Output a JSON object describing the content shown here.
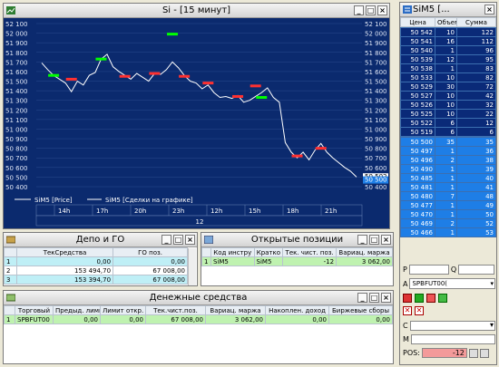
{
  "chart_window": {
    "title": "Si - [15 минут]",
    "y_ticks": [
      "52 100",
      "52 000",
      "51 900",
      "51 800",
      "51 700",
      "51 600",
      "51 500",
      "51 400",
      "51 300",
      "51 200",
      "51 100",
      "51 000",
      "50 900",
      "50 800",
      "50 700",
      "50 600",
      "50 500",
      "50 400"
    ],
    "right_labels": {
      "current": "50 502",
      "bid": "50 500"
    },
    "legend": {
      "price": "SiM5 [Price]",
      "deals": "SiM5 [Сделки на графике]"
    },
    "x_ticks": [
      "14h",
      "17h",
      "20h",
      "23h",
      "12h",
      "15h",
      "18h",
      "21h"
    ],
    "date_label": "12",
    "colors": {
      "bg": "#0b2a6e",
      "line": "#ffffff",
      "buy": "#00ff00",
      "sell": "#ff3030",
      "grid": "#2a4b8e"
    }
  },
  "chart_data": {
    "type": "line",
    "series": [
      {
        "name": "SiM5 [Price]",
        "values": [
          51690,
          51620,
          51560,
          51520,
          51480,
          51390,
          51500,
          51460,
          51560,
          51590,
          51730,
          51780,
          51650,
          51600,
          51560,
          51520,
          51580,
          51540,
          51500,
          51580,
          51570,
          51620,
          51700,
          51640,
          51560,
          51500,
          51480,
          51420,
          51460,
          51380,
          51330,
          51340,
          51320,
          51350,
          51280,
          51300,
          51340,
          51380,
          51430,
          51330,
          51280,
          50860,
          50760,
          50700,
          50760,
          50680,
          50780,
          50850,
          50760,
          50700,
          50650,
          50600,
          50560,
          50500
        ]
      }
    ],
    "deals_buy": [
      {
        "i": 2,
        "y": 51560
      },
      {
        "i": 10,
        "y": 51730
      },
      {
        "i": 22,
        "y": 51990
      },
      {
        "i": 37,
        "y": 51330
      }
    ],
    "deals_sell": [
      {
        "i": 5,
        "y": 51520
      },
      {
        "i": 14,
        "y": 51550
      },
      {
        "i": 19,
        "y": 51580
      },
      {
        "i": 24,
        "y": 51550
      },
      {
        "i": 28,
        "y": 51480
      },
      {
        "i": 33,
        "y": 51340
      },
      {
        "i": 36,
        "y": 51450
      },
      {
        "i": 43,
        "y": 50720
      },
      {
        "i": 47,
        "y": 50800
      }
    ],
    "ylim": [
      50400,
      52100
    ],
    "grid": true,
    "legend": "bottom-left"
  },
  "depo_window": {
    "title": "Депо и ГО",
    "headers": [
      "",
      "ТекСредства",
      "ГО поз."
    ],
    "rows": [
      [
        "1",
        "0,00",
        "0,00"
      ],
      [
        "2",
        "153 494,70",
        "67 008,00"
      ],
      [
        "3",
        "153 394,70",
        "67 008,00"
      ]
    ]
  },
  "positions_window": {
    "title": "Открытые позиции",
    "headers": [
      "",
      "Код инстру",
      "Кратко",
      "Тек. чист. поз.",
      "Вариац. маржа"
    ],
    "rows": [
      [
        "1",
        "SiM5",
        "SiM5",
        "-12",
        "3 062,00"
      ]
    ]
  },
  "money_window": {
    "title": "Денежные средства",
    "headers": [
      "",
      "Торговый",
      "Предыд. лими",
      "Лимит откр.",
      "Тек.чист.поз.",
      "Вариац. маржа",
      "Накоплен. доход",
      "Биржевые сборы"
    ],
    "rows": [
      [
        "1",
        "SPBFUT00",
        "0,00",
        "0,00",
        "67 008,00",
        "3 062,00",
        "0,00",
        "0,00"
      ]
    ]
  },
  "orderbook_window": {
    "title": "SiM5 [...",
    "headers": [
      "Цена",
      "Объем",
      "Сумма"
    ],
    "asks": [
      [
        "50 542",
        "10",
        "122"
      ],
      [
        "50 541",
        "16",
        "112"
      ],
      [
        "50 540",
        "1",
        "96"
      ],
      [
        "50 539",
        "12",
        "95"
      ],
      [
        "50 538",
        "1",
        "83"
      ],
      [
        "50 533",
        "10",
        "82"
      ],
      [
        "50 529",
        "30",
        "72"
      ],
      [
        "50 527",
        "10",
        "42"
      ],
      [
        "50 526",
        "10",
        "32"
      ],
      [
        "50 525",
        "10",
        "22"
      ],
      [
        "50 522",
        "6",
        "12"
      ],
      [
        "50 519",
        "6",
        "6"
      ]
    ],
    "bids": [
      [
        "50 500",
        "35",
        "35"
      ],
      [
        "50 497",
        "1",
        "36"
      ],
      [
        "50 496",
        "2",
        "38"
      ],
      [
        "50 490",
        "1",
        "39"
      ],
      [
        "50 485",
        "1",
        "40"
      ],
      [
        "50 481",
        "1",
        "41"
      ],
      [
        "50 480",
        "7",
        "48"
      ],
      [
        "50 477",
        "1",
        "49"
      ],
      [
        "50 470",
        "1",
        "50"
      ],
      [
        "50 469",
        "2",
        "52"
      ],
      [
        "50 466",
        "1",
        "53"
      ]
    ],
    "labels": {
      "p": "P",
      "q": "Q",
      "a": "A",
      "c": "C",
      "m": "M",
      "pos": "POS:"
    },
    "account": "SPBFUT00(",
    "pos_value": "-12"
  }
}
